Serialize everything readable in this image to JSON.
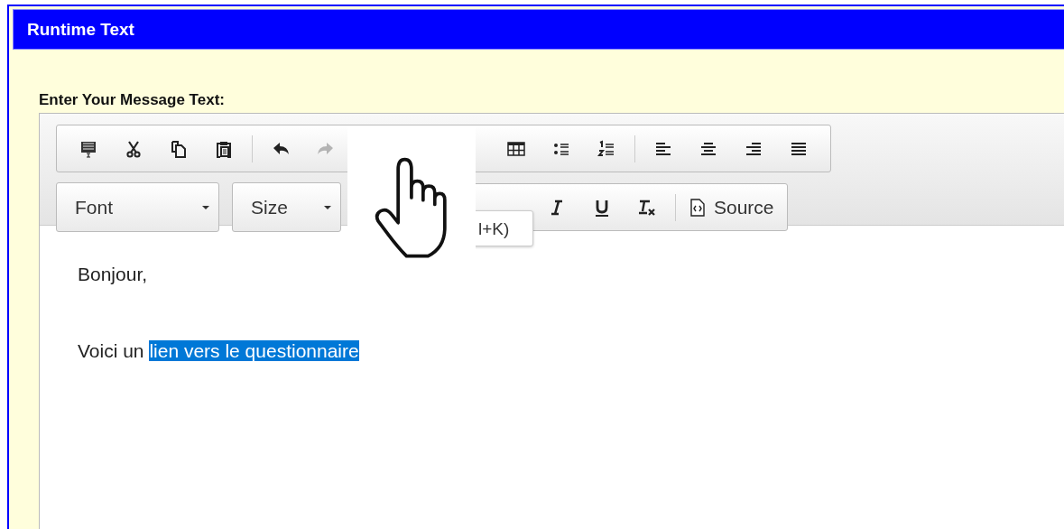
{
  "window": {
    "title": "Runtime Text"
  },
  "label": "Enter Your Message Text:",
  "toolbar": {
    "row_1": [
      {
        "kind": "icon"
      },
      {
        "kind": "icon"
      },
      {
        "kind": "icon"
      },
      {
        "kind": "icon"
      },
      {
        "kind": "separator"
      },
      {
        "kind": "icon"
      },
      {
        "kind": "icon",
        "disabled": true
      },
      {
        "kind": "hidden"
      },
      {
        "kind": "icon"
      },
      {
        "kind": "icon"
      },
      {
        "kind": "icon"
      },
      {
        "kind": "separator"
      },
      {
        "kind": "icon"
      },
      {
        "kind": "icon"
      },
      {
        "kind": "icon"
      },
      {
        "kind": "icon"
      }
    ],
    "combos": [
      {
        "label": "Font"
      },
      {
        "label": "Size"
      }
    ],
    "row_2": [
      {
        "kind": "hidden"
      },
      {
        "kind": "icon"
      },
      {
        "kind": "icon"
      },
      {
        "kind": "icon"
      },
      {
        "kind": "separator"
      },
      {
        "kind": "text",
        "label": "Source"
      }
    ]
  },
  "tooltip": "l+K)",
  "content": [
    {
      "text": "Bonjour,"
    },
    {
      "text": "Voici un ",
      "link": {
        "text": "lien vers le questionnaire",
        "selected": true
      }
    }
  ]
}
